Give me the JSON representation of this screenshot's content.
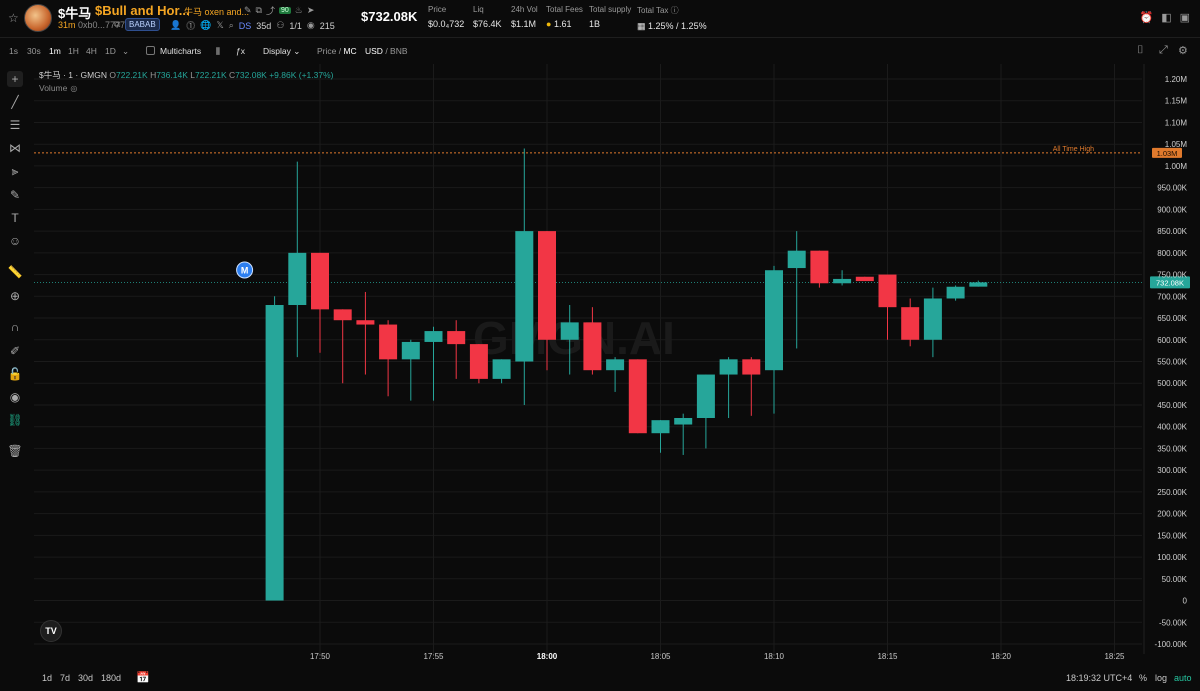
{
  "header": {
    "symbol": "$牛马",
    "name": "$Bull and Hor...",
    "description": "牛马 oxen and...",
    "badge_green": "90",
    "age": "31m",
    "address": "0xb0...7777",
    "tag": "BABAB",
    "ds_label": "DS",
    "ds_age": "35d",
    "ratio": "1/1",
    "views": "215",
    "market_cap": "$732.08K",
    "stats": [
      {
        "label": "Price",
        "value": "$0.0₄732"
      },
      {
        "label": "Liq",
        "value": "$76.4K"
      },
      {
        "label": "24h Vol",
        "value": "$1.1M"
      },
      {
        "label": "Total Fees",
        "value": "1.61"
      },
      {
        "label": "Total supply",
        "value": "1B"
      },
      {
        "label": "Total Tax",
        "value": "1.25% / 1.25%"
      }
    ]
  },
  "toolbar": {
    "intervals": [
      "1s",
      "30s",
      "1m",
      "1H",
      "4H",
      "1D"
    ],
    "active_interval": "1m",
    "multicharts": "Multicharts",
    "display": "Display",
    "price_label": "Price",
    "mc_label": "MC",
    "usd_label": "USD",
    "bnb_label": "BNB"
  },
  "legend": {
    "title": "$牛马 · 1 · GMGN",
    "o_key": "O",
    "o": "722.21K",
    "h_key": "H",
    "h": "736.14K",
    "l_key": "L",
    "l": "722.21K",
    "c_key": "C",
    "c": "732.08K",
    "change": "+9.86K (+1.37%)",
    "volume": "Volume"
  },
  "watermark": "GMGN.AI",
  "chart_data": {
    "type": "candlestick",
    "unit": "market cap (USD)",
    "x_ticks": [
      "17:50",
      "17:55",
      "18:00",
      "18:05",
      "18:10",
      "18:15",
      "18:20",
      "18:25"
    ],
    "y_ticks": [
      "-100.00K",
      "-50.00K",
      "0",
      "50.00K",
      "100.00K",
      "150.00K",
      "200.00K",
      "250.00K",
      "300.00K",
      "350.00K",
      "400.00K",
      "450.00K",
      "500.00K",
      "550.00K",
      "600.00K",
      "650.00K",
      "700.00K",
      "750.00K",
      "800.00K",
      "850.00K",
      "900.00K",
      "950.00K",
      "1.00M",
      "1.05M",
      "1.10M",
      "1.15M",
      "1.20M"
    ],
    "ylim": [
      -100000,
      1200000
    ],
    "all_time_high": {
      "label": "All Time High",
      "value_label": "1.03M",
      "value": 1030000
    },
    "current_price": {
      "label": "732.08K",
      "value": 732080
    },
    "marker_label": "M",
    "up_color": "#26a69a",
    "down_color": "#f23645",
    "candles": [
      {
        "time": "17:48",
        "o": 0,
        "h": 700000,
        "l": 0,
        "c": 680000
      },
      {
        "time": "17:49",
        "o": 680000,
        "h": 1010000,
        "l": 560000,
        "c": 800000
      },
      {
        "time": "17:50",
        "o": 800000,
        "h": 800000,
        "l": 570000,
        "c": 670000
      },
      {
        "time": "17:51",
        "o": 670000,
        "h": 670000,
        "l": 500000,
        "c": 645000
      },
      {
        "time": "17:52",
        "o": 645000,
        "h": 710000,
        "l": 520000,
        "c": 635000
      },
      {
        "time": "17:53",
        "o": 635000,
        "h": 645000,
        "l": 470000,
        "c": 555000
      },
      {
        "time": "17:54",
        "o": 555000,
        "h": 600000,
        "l": 460000,
        "c": 595000
      },
      {
        "time": "17:55",
        "o": 595000,
        "h": 630000,
        "l": 460000,
        "c": 620000
      },
      {
        "time": "17:56",
        "o": 620000,
        "h": 645000,
        "l": 510000,
        "c": 590000
      },
      {
        "time": "17:57",
        "o": 590000,
        "h": 590000,
        "l": 500000,
        "c": 510000
      },
      {
        "time": "17:58",
        "o": 510000,
        "h": 555000,
        "l": 500000,
        "c": 555000
      },
      {
        "time": "17:59",
        "o": 550000,
        "h": 1040000,
        "l": 450000,
        "c": 850000
      },
      {
        "time": "18:00",
        "o": 850000,
        "h": 850000,
        "l": 530000,
        "c": 600000
      },
      {
        "time": "18:01",
        "o": 600000,
        "h": 680000,
        "l": 520000,
        "c": 640000
      },
      {
        "time": "18:02",
        "o": 640000,
        "h": 675000,
        "l": 520000,
        "c": 530000
      },
      {
        "time": "18:03",
        "o": 530000,
        "h": 560000,
        "l": 480000,
        "c": 555000
      },
      {
        "time": "18:04",
        "o": 555000,
        "h": 555000,
        "l": 385000,
        "c": 385000
      },
      {
        "time": "18:05",
        "o": 385000,
        "h": 415000,
        "l": 340000,
        "c": 415000
      },
      {
        "time": "18:06",
        "o": 405000,
        "h": 430000,
        "l": 335000,
        "c": 420000
      },
      {
        "time": "18:07",
        "o": 420000,
        "h": 520000,
        "l": 350000,
        "c": 520000
      },
      {
        "time": "18:08",
        "o": 520000,
        "h": 560000,
        "l": 420000,
        "c": 555000
      },
      {
        "time": "18:09",
        "o": 555000,
        "h": 560000,
        "l": 425000,
        "c": 520000
      },
      {
        "time": "18:10",
        "o": 530000,
        "h": 770000,
        "l": 430000,
        "c": 760000
      },
      {
        "time": "18:11",
        "o": 765000,
        "h": 850000,
        "l": 580000,
        "c": 805000
      },
      {
        "time": "18:12",
        "o": 805000,
        "h": 805000,
        "l": 720000,
        "c": 730000
      },
      {
        "time": "18:13",
        "o": 730000,
        "h": 760000,
        "l": 725000,
        "c": 740000
      },
      {
        "time": "18:14",
        "o": 745000,
        "h": 745000,
        "l": 740000,
        "c": 735000
      },
      {
        "time": "18:15",
        "o": 750000,
        "h": 750000,
        "l": 600000,
        "c": 675000
      },
      {
        "time": "18:16",
        "o": 675000,
        "h": 695000,
        "l": 585000,
        "c": 600000
      },
      {
        "time": "18:17",
        "o": 600000,
        "h": 720000,
        "l": 560000,
        "c": 695000
      },
      {
        "time": "18:18",
        "o": 695000,
        "h": 725000,
        "l": 690000,
        "c": 722000
      },
      {
        "time": "18:19",
        "o": 722210,
        "h": 736140,
        "l": 722210,
        "c": 732080
      }
    ]
  },
  "bottom": {
    "ranges": [
      "1d",
      "7d",
      "30d",
      "180d"
    ],
    "timestamp": "18:19:32 UTC+4",
    "percent": "%",
    "log": "log",
    "auto": "auto"
  }
}
